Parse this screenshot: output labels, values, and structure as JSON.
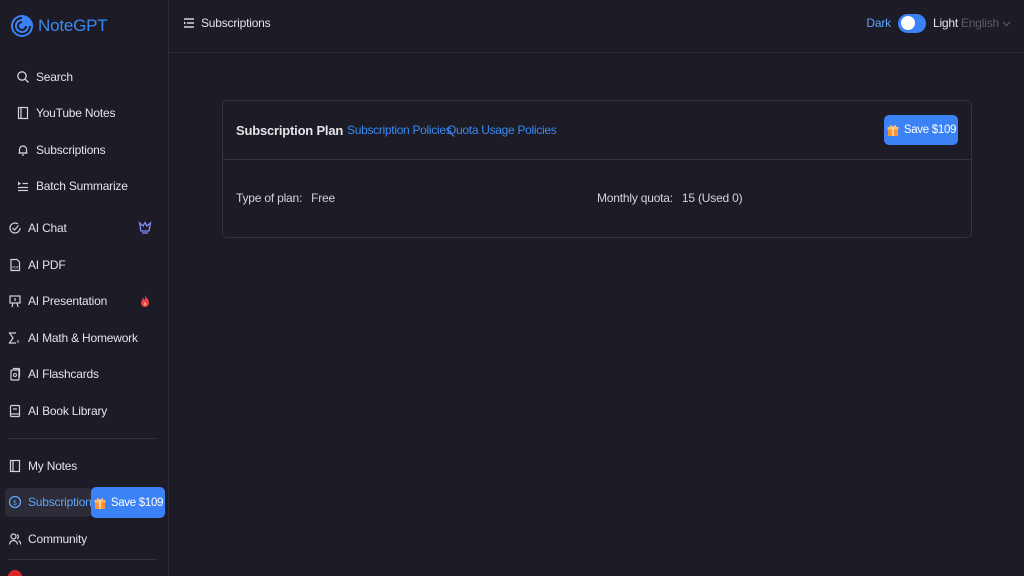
{
  "app": {
    "name": "NoteGPT",
    "accent": "#3b82f6"
  },
  "sidebar": {
    "sub_items": [
      {
        "label": "Search",
        "icon": "search-icon"
      },
      {
        "label": "YouTube Notes",
        "icon": "notebook-icon"
      },
      {
        "label": "Subscriptions",
        "icon": "bell-icon"
      },
      {
        "label": "Batch Summarize",
        "icon": "list-play-icon"
      }
    ],
    "ai_items": [
      {
        "label": "AI Chat",
        "icon": "chat-icon",
        "badge": "crown-badge-icon"
      },
      {
        "label": "AI PDF",
        "icon": "pdf-icon"
      },
      {
        "label": "AI Presentation",
        "icon": "presentation-icon",
        "badge": "fire-badge-icon"
      },
      {
        "label": "AI Math & Homework",
        "icon": "sigma-icon"
      },
      {
        "label": "AI Flashcards",
        "icon": "flashcards-icon"
      },
      {
        "label": "AI Book Library",
        "icon": "book-icon"
      }
    ],
    "bottom_items": [
      {
        "label": "My Notes",
        "icon": "notebook-icon"
      },
      {
        "label": "Subscriptions",
        "icon": "dollar-circle-icon",
        "active": true
      },
      {
        "label": "Community",
        "icon": "users-icon"
      }
    ],
    "save_chip": "Save $109"
  },
  "header": {
    "title": "Subscriptions",
    "theme_dark": "Dark",
    "theme_light": "Light",
    "language": "English"
  },
  "card": {
    "title": "Subscription Plan",
    "links": [
      "Subscription Policies",
      "Quota Usage Policies"
    ],
    "save_button": "Save $109",
    "plan_label": "Type of plan:",
    "plan_value": "Free",
    "quota_label": "Monthly quota:",
    "quota_value": "15 (Used 0)"
  }
}
